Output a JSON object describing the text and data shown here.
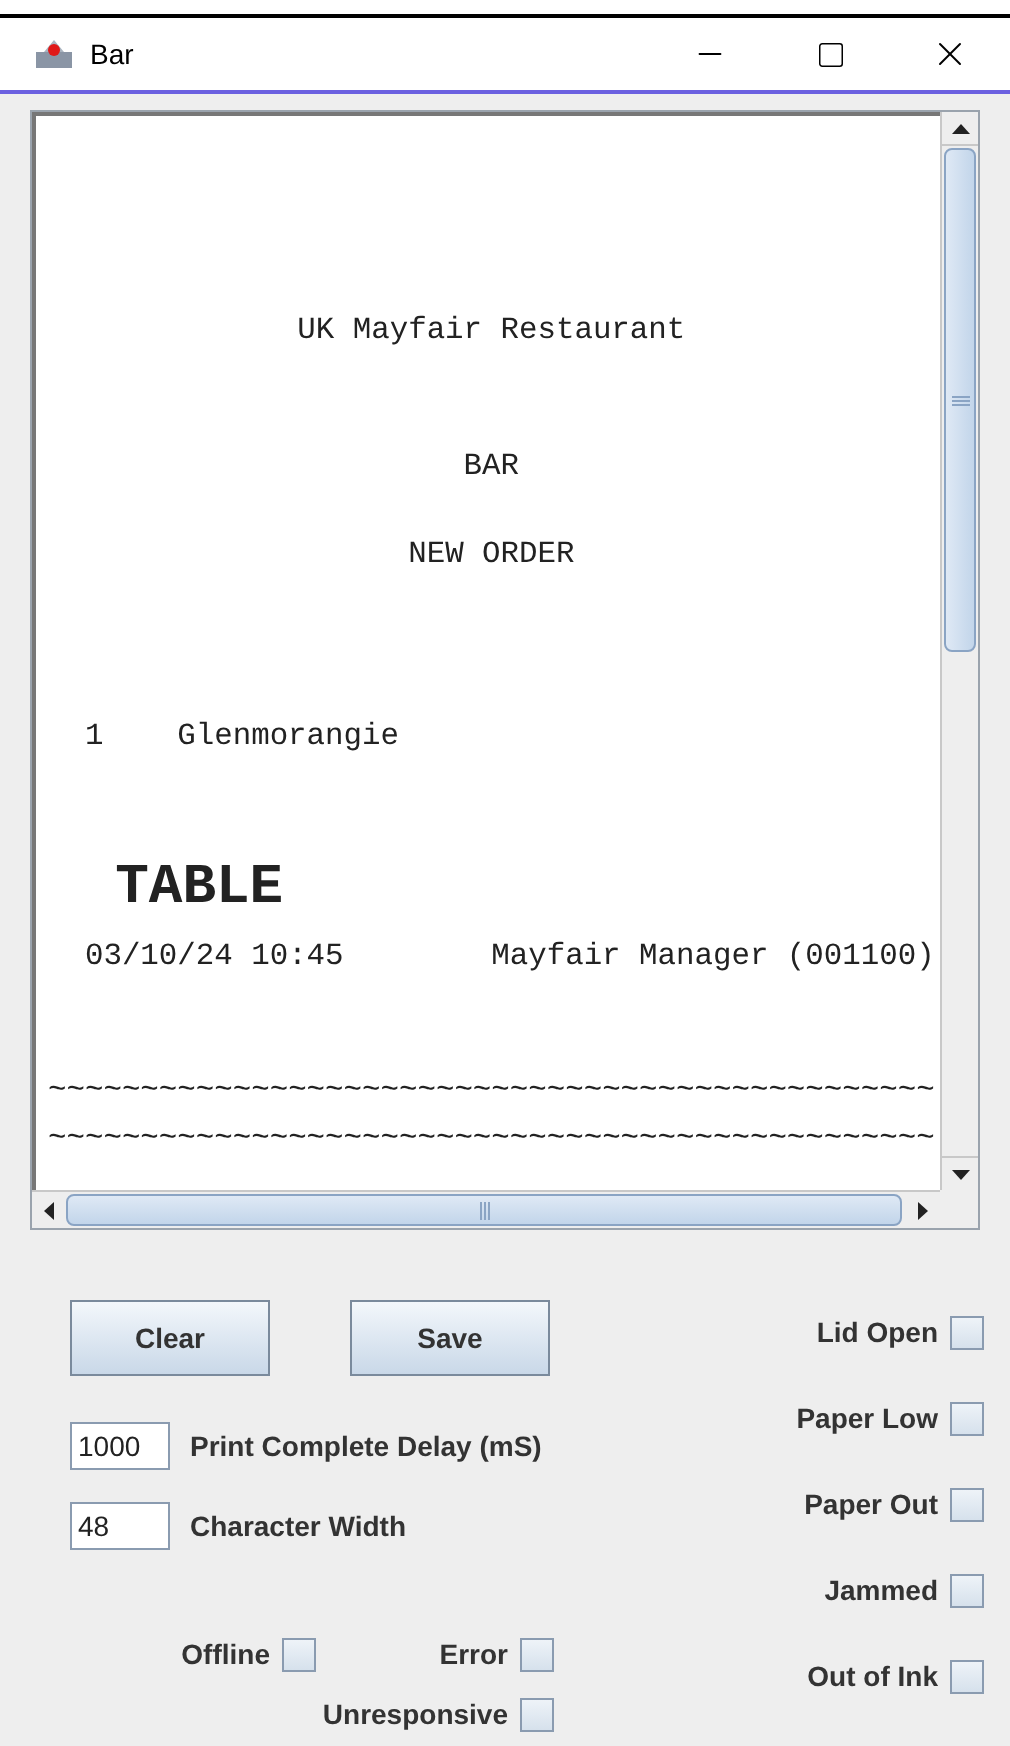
{
  "window": {
    "title": "Bar"
  },
  "receipt": {
    "header": [
      "UK Mayfair Restaurant",
      "BAR",
      "NEW ORDER"
    ],
    "items": [
      {
        "qty": "1",
        "name": "Glenmorangie"
      }
    ],
    "table_label": "TABLE",
    "timestamp": "03/10/24 10:45",
    "server": "Mayfair Manager (001100)",
    "rules": [
      "~~~~~~~~~~~~~~~~~~~~~~~~~~~~~~~~~~~~~~~~~~~~~~~~",
      "~~~~~~~~~~~~~~~~~~~~~~~~~~~~~~~~~~~~~~~~~~~~~~~~"
    ]
  },
  "buttons": [
    "Clear",
    "Save"
  ],
  "fields": [
    {
      "value": "1000",
      "label": "Print Complete Delay (mS)"
    },
    {
      "value": "48",
      "label": "Character Width"
    }
  ],
  "status_checks": [
    {
      "label": "Lid Open",
      "checked": false
    },
    {
      "label": "Paper Low",
      "checked": false
    },
    {
      "label": "Paper Out",
      "checked": false
    },
    {
      "label": "Jammed",
      "checked": false
    },
    {
      "label": "Out of Ink",
      "checked": false
    }
  ],
  "state_checks": [
    {
      "label": "Offline",
      "checked": false
    },
    {
      "label": "Error",
      "checked": false
    },
    {
      "label": "Unresponsive",
      "checked": false
    }
  ]
}
